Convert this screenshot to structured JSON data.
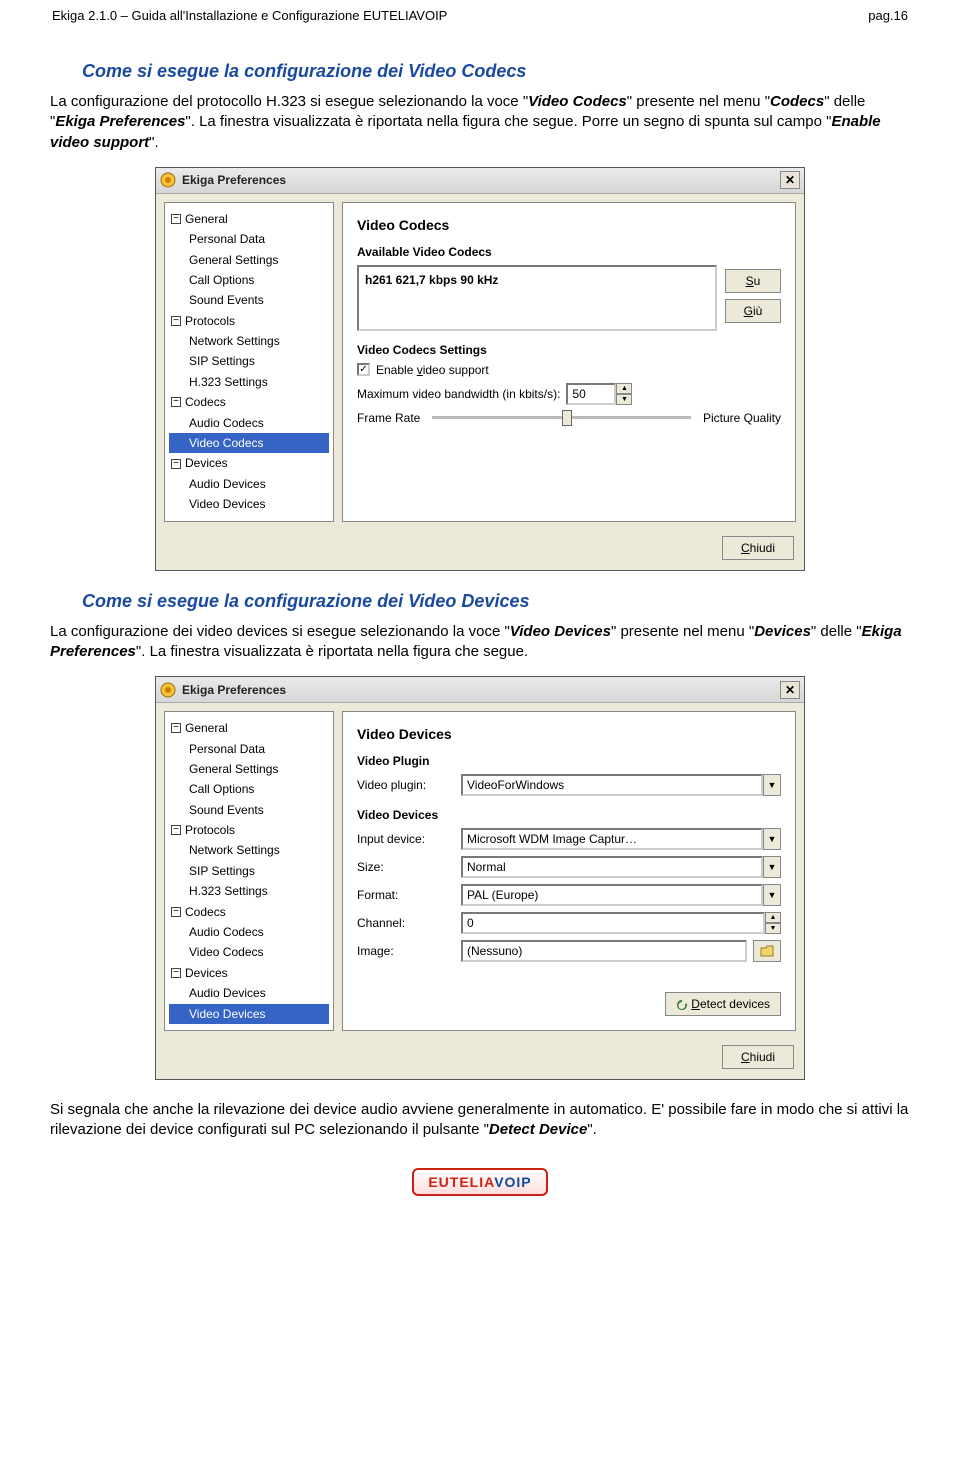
{
  "doc": {
    "header_left": "Ekiga 2.1.0 – Guida all'Installazione e Configurazione EUTELIAVOIP",
    "header_right": "pag.16"
  },
  "section1": {
    "title": "Come si esegue la configurazione dei Video Codecs",
    "para": "La configurazione del protocollo H.323 si esegue selezionando la voce \"Video Codecs\" presente nel menu \"Codecs\" delle \"Ekiga Preferences\". La finestra visualizzata è riportata nella figura che segue. Porre un segno di spunta sul campo \"Enable video support\"."
  },
  "section2": {
    "title": "Come si esegue la configurazione dei Video Devices",
    "para": "La configurazione dei video devices si esegue selezionando la voce \"Video Devices\" presente nel menu \"Devices\" delle \"Ekiga Preferences\". La finestra visualizzata è riportata nella figura che segue."
  },
  "footnote": "Si segnala che anche la rilevazione dei device audio avviene generalmente in automatico. E' possibile fare in modo che si attivi la rilevazione dei device configurati sul PC selezionando il pulsante \"Detect Device\".",
  "dialog_common": {
    "title": "Ekiga Preferences",
    "close_label": "Chiudi",
    "tree": {
      "general": "General",
      "personal": "Personal Data",
      "gensettings": "General Settings",
      "callopts": "Call Options",
      "soundev": "Sound Events",
      "protocols": "Protocols",
      "netset": "Network Settings",
      "sipset": "SIP Settings",
      "h323set": "H.323 Settings",
      "codecs": "Codecs",
      "audiocodecs": "Audio Codecs",
      "videocodecs": "Video Codecs",
      "devices": "Devices",
      "audiodev": "Audio Devices",
      "videodev": "Video Devices"
    }
  },
  "dlg1": {
    "panel_title": "Video Codecs",
    "section_avail": "Available Video Codecs",
    "codec_line": "h261   621,7 kbps   90 kHz",
    "btn_up": "Su",
    "btn_down": "Giù",
    "section_settings": "Video Codecs Settings",
    "enable_label": "Enable video support",
    "bw_label": "Maximum video bandwidth (in kbits/s):",
    "bw_value": "50",
    "fr_label": "Frame Rate",
    "pq_label": "Picture Quality"
  },
  "dlg2": {
    "panel_title": "Video Devices",
    "section_plugin": "Video Plugin",
    "plugin_label": "Video plugin:",
    "plugin_value": "VideoForWindows",
    "section_dev": "Video Devices",
    "input_label": "Input device:",
    "input_value": "Microsoft WDM Image Captur…",
    "size_label": "Size:",
    "size_value": "Normal",
    "format_label": "Format:",
    "format_value": "PAL (Europe)",
    "channel_label": "Channel:",
    "channel_value": "0",
    "image_label": "Image:",
    "image_value": "(Nessuno)",
    "detect_btn": "Detect devices"
  },
  "logo": {
    "part1": "EUTELIA",
    "part2": "VOIP"
  }
}
